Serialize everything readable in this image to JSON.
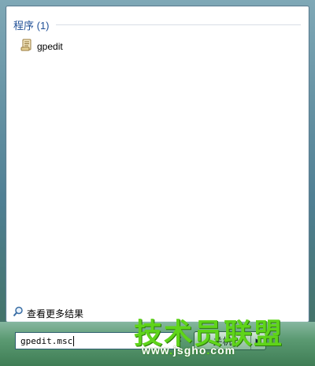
{
  "results": {
    "section_title": "程序 (1)",
    "items": [
      {
        "label": "gpedit",
        "icon": "script-file-icon"
      }
    ]
  },
  "see_more": {
    "label": "查看更多结果",
    "icon": "search-icon"
  },
  "search": {
    "value": "gpedit.msc"
  },
  "shutdown": {
    "label": "关机"
  },
  "watermark": {
    "cn_text": "技术员联盟",
    "url_prefix": "www",
    "url_main": "jsgho",
    "url_tld": "com"
  }
}
